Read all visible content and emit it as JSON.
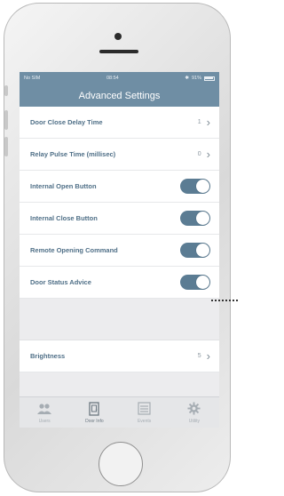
{
  "status_bar": {
    "carrier": "No SIM",
    "time": "08:54",
    "battery": "91%"
  },
  "nav": {
    "title": "Advanced Settings"
  },
  "rows": [
    {
      "label": "Door Close Delay Time",
      "value": "1",
      "type": "disclosure"
    },
    {
      "label": "Relay Pulse Time (millisec)",
      "value": "0",
      "type": "disclosure"
    },
    {
      "label": "Internal Open Button",
      "type": "toggle",
      "on": true
    },
    {
      "label": "Internal Close Button",
      "type": "toggle",
      "on": true
    },
    {
      "label": "Remote Opening Command",
      "type": "toggle",
      "on": true
    },
    {
      "label": "Door Status Advice",
      "type": "toggle",
      "on": true
    }
  ],
  "brightness": {
    "label": "Brightness",
    "value": "5"
  },
  "tabs": [
    {
      "label": "Users",
      "icon": "users-icon"
    },
    {
      "label": "Door Info",
      "icon": "door-icon",
      "active": true
    },
    {
      "label": "Events",
      "icon": "list-icon"
    },
    {
      "label": "Utility",
      "icon": "gear-icon"
    }
  ],
  "colors": {
    "accent": "#6f8ea4",
    "toggle_on": "#5b7c93",
    "label": "#4f6f87"
  }
}
